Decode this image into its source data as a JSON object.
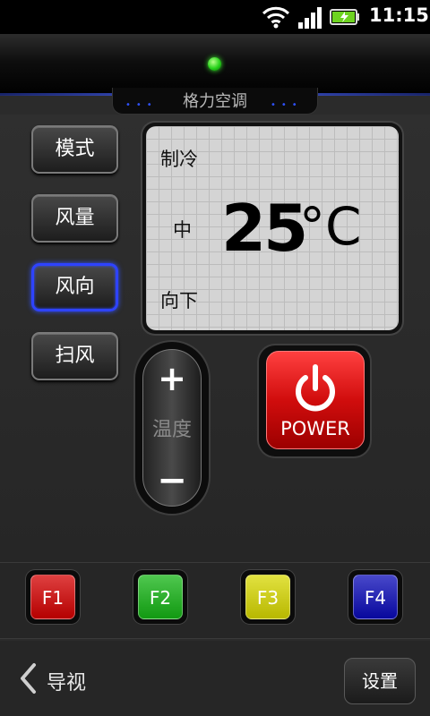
{
  "status_bar": {
    "time": "11:15"
  },
  "remote": {
    "brand": "格力空调"
  },
  "side_buttons": {
    "mode": "模式",
    "fan_speed": "风量",
    "direction": "风向",
    "swing": "扫风"
  },
  "display": {
    "mode": "制冷",
    "fan": "中",
    "direction": "向下",
    "temperature": "25",
    "unit": "°C"
  },
  "temp_control": {
    "plus": "+",
    "label": "温度",
    "minus": "−"
  },
  "power": {
    "label": "POWER"
  },
  "function_keys": [
    {
      "label": "F1",
      "color": "#d40000"
    },
    {
      "label": "F2",
      "color": "#14b414"
    },
    {
      "label": "F3",
      "color": "#d8d800"
    },
    {
      "label": "F4",
      "color": "#0a0ab8"
    }
  ],
  "nav": {
    "back_label": "导视",
    "settings_label": "设置"
  }
}
